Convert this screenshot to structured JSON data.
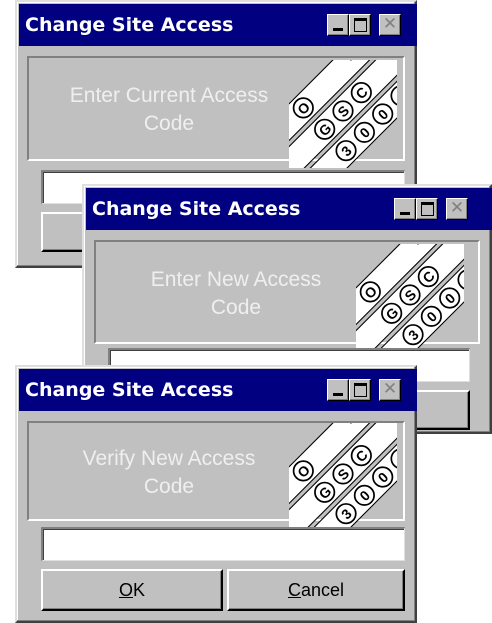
{
  "windows": [
    {
      "title": "Change Site Access",
      "prompt_line1": "Enter Current Access",
      "prompt_line2": "Code",
      "code_value": ""
    },
    {
      "title": "Change Site Access",
      "prompt_line1": "Enter New Access",
      "prompt_line2": "Code",
      "code_value": ""
    },
    {
      "title": "Change Site Access",
      "prompt_line1": "Verify New Access",
      "prompt_line2": "Code",
      "code_value": "",
      "ok_mnemonic": "O",
      "ok_rest": "K",
      "cancel_mnemonic": "C",
      "cancel_rest": "ancel"
    }
  ],
  "title_controls": {
    "close_glyph": "✕"
  },
  "logo": {
    "name": "gsc-keypad-logo",
    "key_labels": [
      "O",
      "G",
      "S",
      "C",
      "3",
      "0",
      "0",
      "0"
    ]
  },
  "colors": {
    "titlebar": "#000080",
    "face": "#c0c0c0",
    "prompt_text": "#efefef"
  }
}
